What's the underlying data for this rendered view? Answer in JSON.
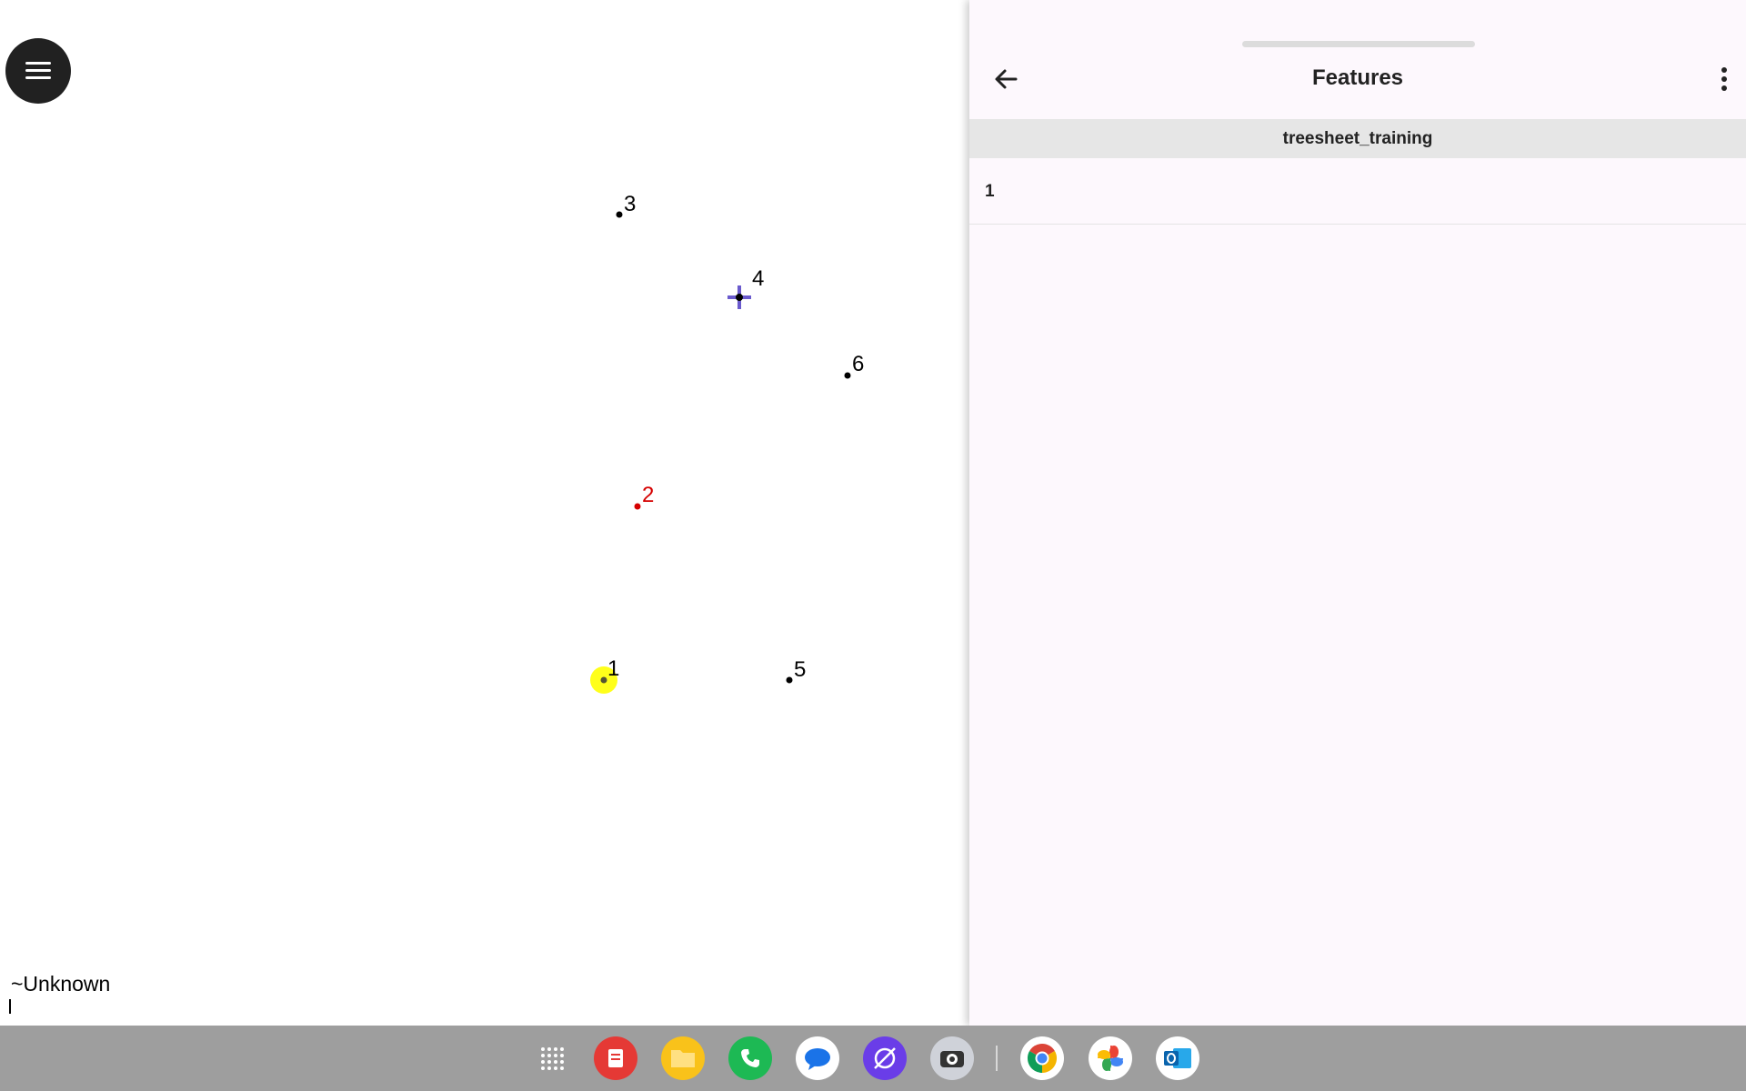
{
  "map": {
    "points": [
      {
        "label": "1",
        "color": "#000000",
        "highlighted": true
      },
      {
        "label": "2",
        "color": "#d50000",
        "highlighted": false
      },
      {
        "label": "3",
        "color": "#000000",
        "highlighted": false
      },
      {
        "label": "4",
        "color": "#000000",
        "highlighted": false,
        "crosshair": true
      },
      {
        "label": "5",
        "color": "#000000",
        "highlighted": false
      },
      {
        "label": "6",
        "color": "#000000",
        "highlighted": false
      }
    ],
    "status_text": "~Unknown",
    "highlight_color": "#ffff1a",
    "crosshair_color": "#6a5acd"
  },
  "panel": {
    "title": "Features",
    "layer_name": "treesheet_training",
    "features": [
      {
        "label": "1"
      }
    ]
  },
  "taskbar": {
    "apps": [
      {
        "name": "app-drawer-icon",
        "color": "#9e9e9e"
      },
      {
        "name": "notes-app-icon",
        "color": "#e53935"
      },
      {
        "name": "files-app-icon",
        "color": "#f9c21a"
      },
      {
        "name": "phone-app-icon",
        "color": "#1db954"
      },
      {
        "name": "messages-app-icon",
        "color": "#ffffff"
      },
      {
        "name": "browser-app-icon",
        "color": "#6a3de8"
      },
      {
        "name": "camera-app-icon",
        "color": "#cfd2d9"
      },
      {
        "name": "chrome-app-icon",
        "color": "#ffffff"
      },
      {
        "name": "photos-app-icon",
        "color": "#ffffff"
      },
      {
        "name": "outlook-app-icon",
        "color": "#ffffff"
      }
    ]
  }
}
